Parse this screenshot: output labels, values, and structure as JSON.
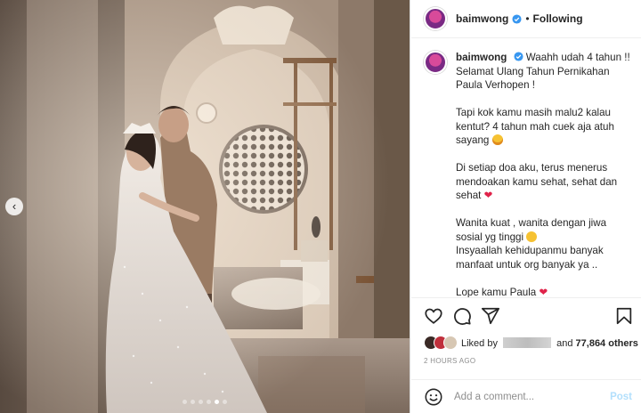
{
  "post": {
    "username": "baimwong",
    "following_label": "Following",
    "separator": "•"
  },
  "caption": {
    "username": "baimwong",
    "paragraphs": [
      "Waahh udah 4 tahun !! Selamat Ulang Tahun Pernikahan Paula Verhopen !",
      "Tapi kok kamu masih malu2 kalau kentut? 4 tahun mah cuek aja atuh sayang",
      "Di setiap doa aku, terus menerus mendoakan kamu sehat, sehat dan sehat",
      "Wanita kuat , wanita dengan jiwa sosial yg tinggi",
      "Insyaallah kehidupanmu banyak manfaat untuk org banyak ya ..",
      "Lope kamu Paula"
    ]
  },
  "likes": {
    "prefix": "Liked by",
    "joiner": "and",
    "count": "77,864 others"
  },
  "timestamp": "2 HOURS AGO",
  "comment": {
    "placeholder": "Add a comment...",
    "post_label": "Post"
  },
  "carousel": {
    "total": 6,
    "active": 5,
    "prev_glyph": "‹"
  },
  "colors": {
    "heart": "#e0234a",
    "verified": "#3897f0",
    "post_disabled": "#b2dffc",
    "muted": "#8e8e8e"
  },
  "icons": [
    "heart-icon",
    "comment-icon",
    "share-icon",
    "bookmark-icon",
    "emoji-icon",
    "verified-icon"
  ]
}
